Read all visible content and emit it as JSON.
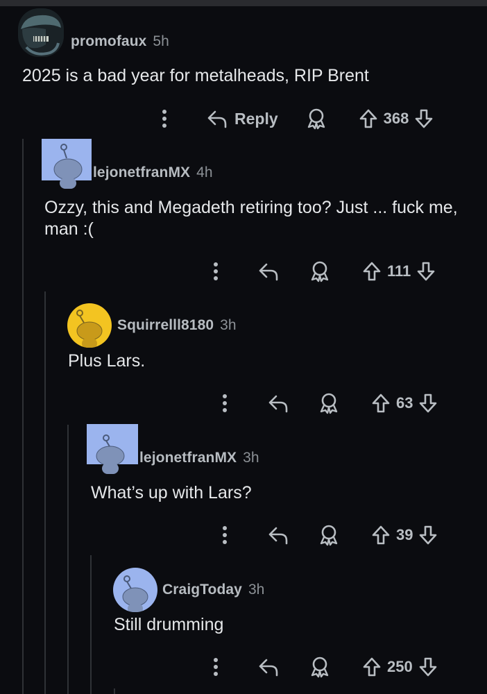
{
  "comments": [
    {
      "username": "promofaux",
      "time": "5h",
      "body": "2025 is a bad year for metalheads, RIP Brent",
      "reply_label": "Reply",
      "score": "368"
    },
    {
      "username": "lejonetfranMX",
      "time": "4h",
      "body": "Ozzy, this and Megadeth retiring too? Just ... fuck me, man :(",
      "score": "111"
    },
    {
      "username": "Squirrelll8180",
      "time": "3h",
      "body": "Plus Lars.",
      "score": "63"
    },
    {
      "username": "lejonetfranMX",
      "time": "3h",
      "body": "What’s up with Lars?",
      "score": "39"
    },
    {
      "username": "CraigToday",
      "time": "3h",
      "body": "Still drumming",
      "score": "250"
    }
  ],
  "colors": {
    "background": "#0b0c10",
    "username": "#b7bcc1",
    "body_text": "#e6e8ea",
    "avatar_blue": "#9bb4ee",
    "avatar_yellow": "#f3c421"
  },
  "icons": [
    "more-vertical-icon",
    "reply-arrow-icon",
    "award-icon",
    "upvote-arrow-icon",
    "downvote-arrow-icon",
    "snoo-avatar-icon",
    "alien-avatar-icon"
  ]
}
